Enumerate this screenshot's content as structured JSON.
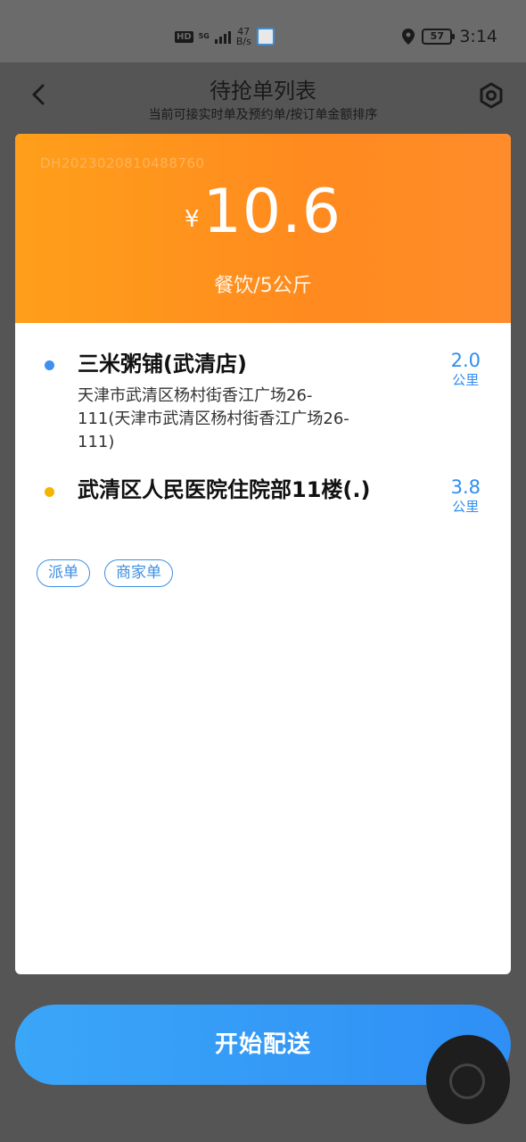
{
  "status_bar": {
    "hd": "HD",
    "signal": "5G",
    "net_speed_value": "47",
    "net_speed_unit": "B/s",
    "battery": "57",
    "time": "3:14"
  },
  "header": {
    "title": "待抢单列表",
    "subtitle": "当前可接实时单及预约单/按订单金额排序"
  },
  "order": {
    "order_no": "DH2023020810488760",
    "currency": "¥",
    "amount": "10.6",
    "category": "餐饮/5公斤",
    "pickup": {
      "name": "三米粥铺(武清店)",
      "address": "天津市武清区杨村街香江广场26-111(天津市武清区杨村街香江广场26-111)",
      "distance": "2.0",
      "unit": "公里",
      "dot_color": "#3d8ff0"
    },
    "dropoff": {
      "name": "武清区人民医院住院部11楼(.)",
      "distance": "3.8",
      "unit": "公里",
      "dot_color": "#f5b400"
    },
    "tags": [
      "派单",
      "商家单"
    ]
  },
  "actions": {
    "start_label": "开始配送"
  },
  "colors": {
    "accent": "#2f8ff5",
    "orange": "#ff8f1f"
  }
}
